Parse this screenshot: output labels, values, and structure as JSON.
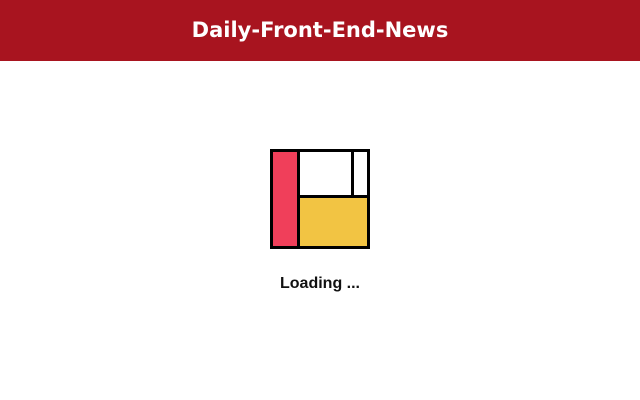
{
  "header": {
    "title": "Daily-Front-End-News",
    "background": "#a8141f",
    "text_color": "#ffffff"
  },
  "loader": {
    "icon": "mondrian-loader-icon",
    "colors": {
      "border": "#000000",
      "red_block": "#f03f5a",
      "yellow_block": "#f2c443",
      "white_block": "#ffffff"
    }
  },
  "status": {
    "loading_text": "Loading ..."
  }
}
